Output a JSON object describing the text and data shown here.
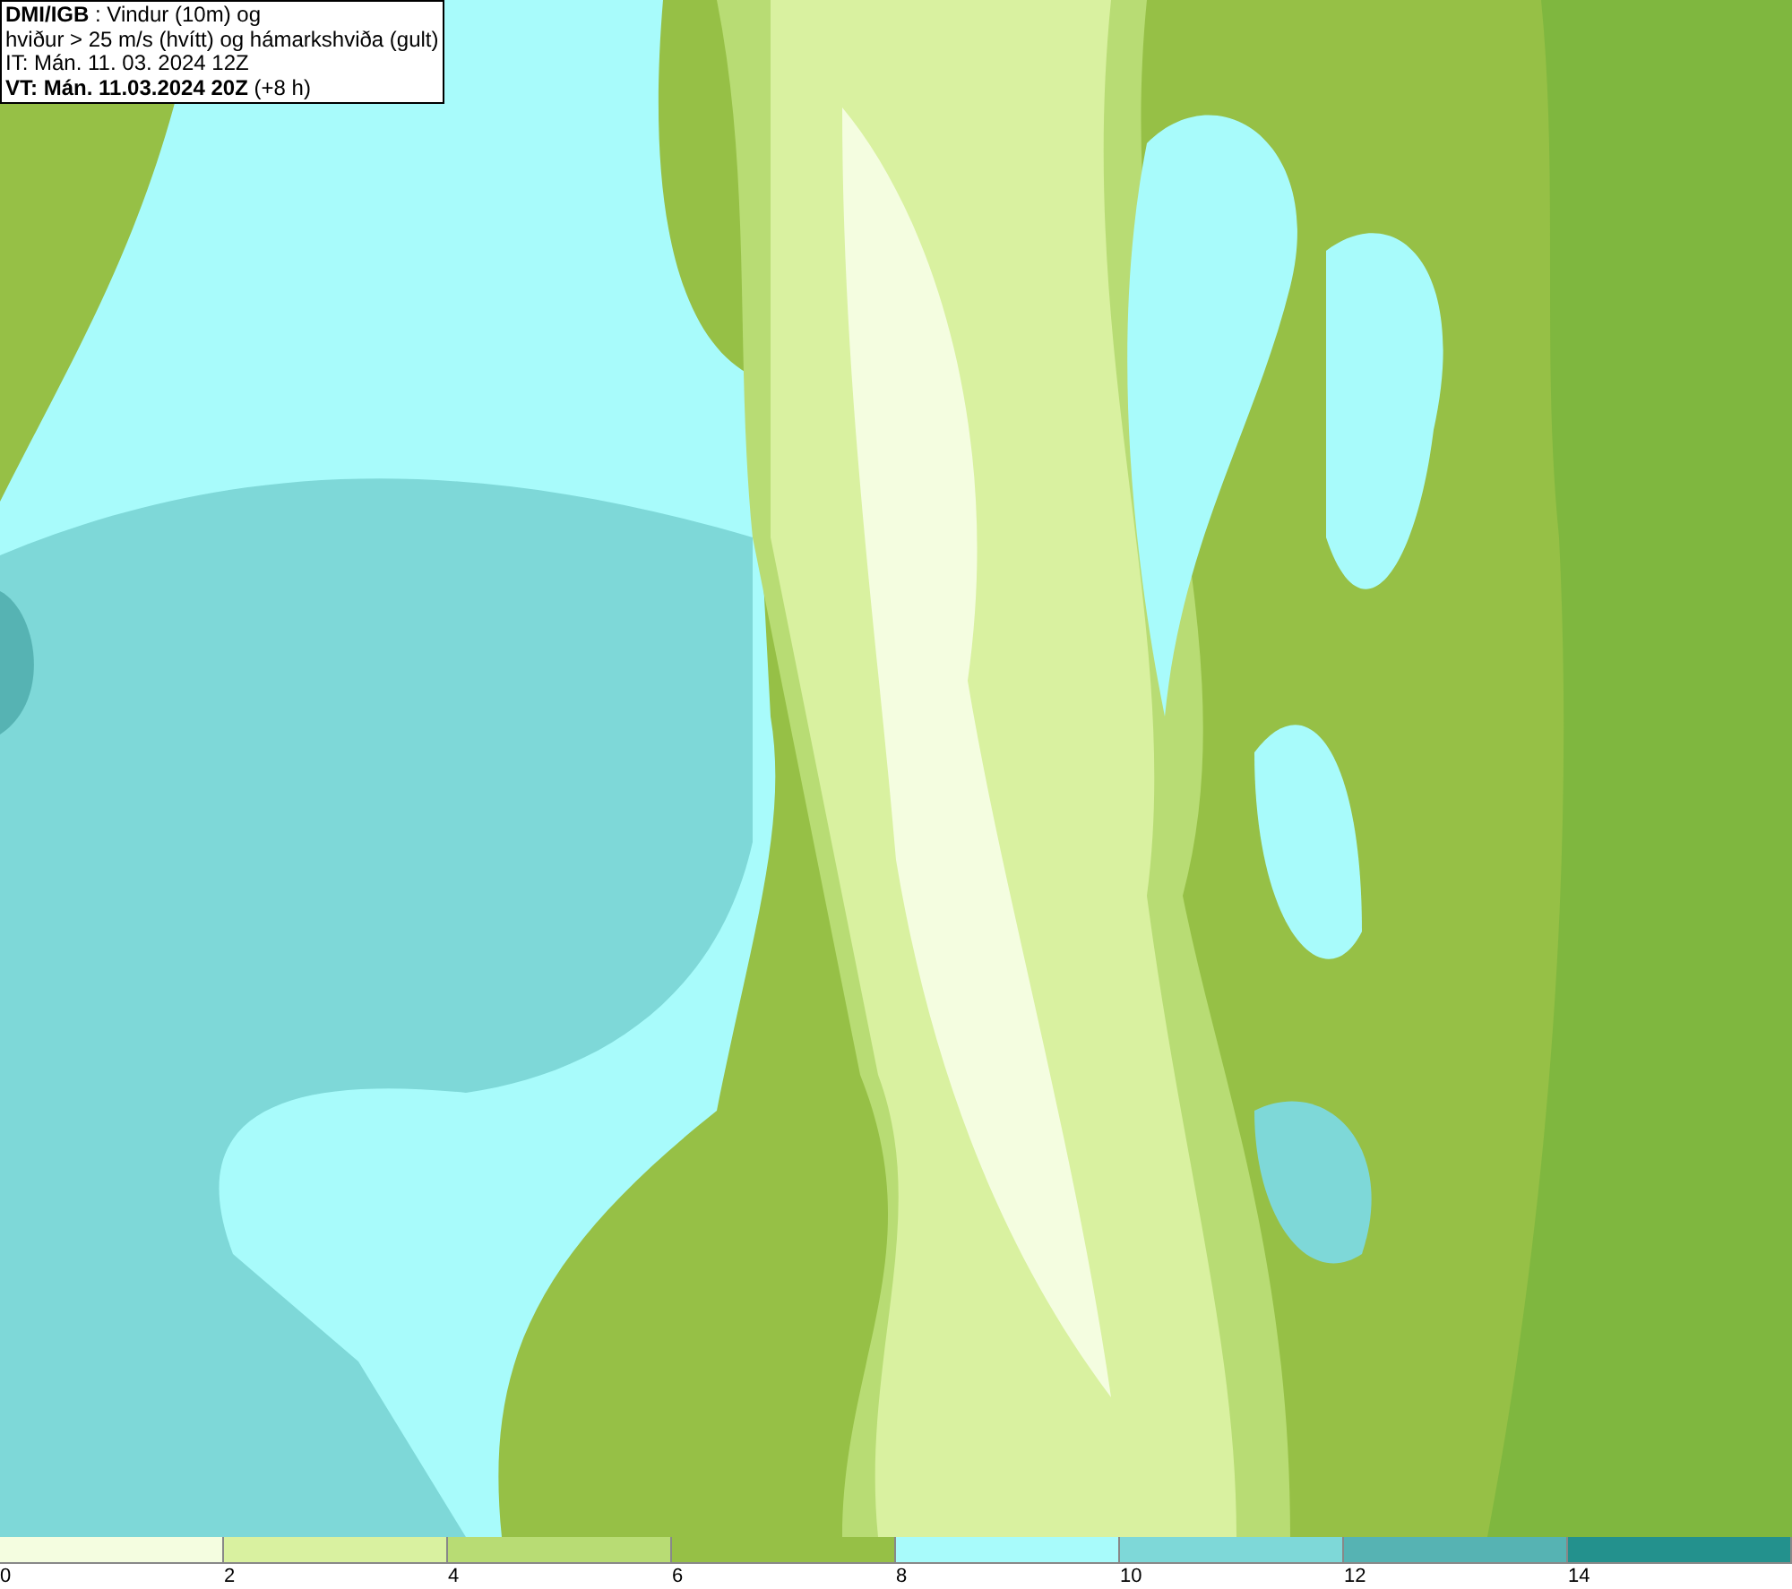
{
  "header": {
    "lines": [
      "**DMI/IGB** : Vindur (10m) og",
      "hviður > 25 m/s (hvítt) og hámarkshviða (gult)",
      "IT: Mán. 11. 03. 2024 12Z",
      "**VT: Mán. 11.03.2024 20Z** (+8 h)"
    ]
  },
  "legend": [
    {
      "label": "0",
      "color": "#f4fde0"
    },
    {
      "label": "2",
      "color": "#d9f1a0"
    },
    {
      "label": "4",
      "color": "#b8dc74"
    },
    {
      "label": "6",
      "color": "#96c046"
    },
    {
      "label": "8",
      "color": "#a8fbfb"
    },
    {
      "label": "10",
      "color": "#7ed8d8"
    },
    {
      "label": "12",
      "color": "#56b3b3"
    },
    {
      "label": "14",
      "color": "#23918d"
    }
  ]
}
